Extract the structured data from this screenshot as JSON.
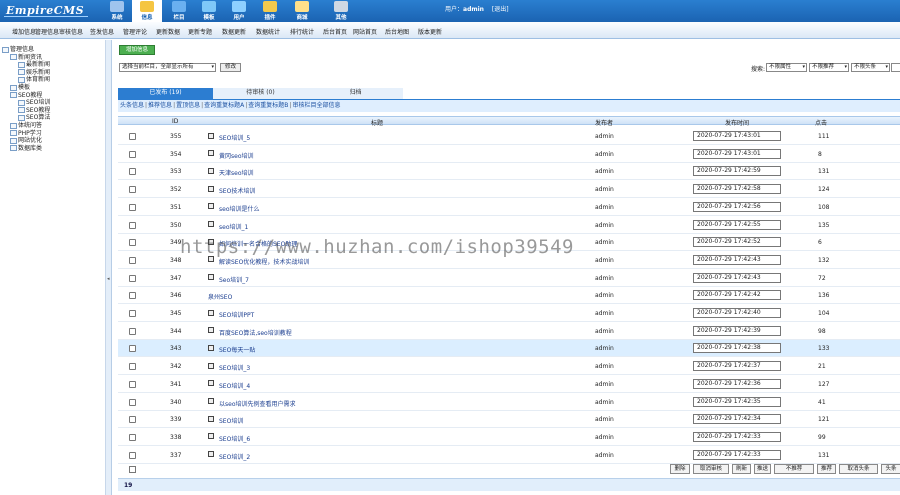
{
  "logo": "EmpireCMS",
  "topnav": [
    {
      "label": "系统",
      "icon": "system-icon",
      "color": "#9fc4ee"
    },
    {
      "label": "信息",
      "icon": "pencil-icon",
      "color": "#f5c542"
    },
    {
      "label": "栏目",
      "icon": "column-icon",
      "color": "#6ab0f0"
    },
    {
      "label": "模板",
      "icon": "template-icon",
      "color": "#7fc8f8"
    },
    {
      "label": "用户",
      "icon": "user-icon",
      "color": "#8ed0ff"
    },
    {
      "label": "插件",
      "icon": "plugin-icon",
      "color": "#f2c94c"
    },
    {
      "label": "商城",
      "icon": "shop-icon",
      "color": "#ffe08a"
    },
    {
      "label": "其他",
      "icon": "gear-icon",
      "color": "#cfd8e3"
    }
  ],
  "userinfo": {
    "prefix": "用户：",
    "user": "admin",
    "logout": "[退出]"
  },
  "menubar": [
    "增加信息",
    "管理信息",
    "审核信息",
    "签发信息",
    "管理评论",
    "更新数据",
    "更新专题",
    "数据更新",
    "数据统计",
    "排行统计",
    "后台首页",
    "网站首页",
    "后台地图",
    "版本更新"
  ],
  "sidebar": [
    {
      "label": "管理信息",
      "level": 0
    },
    {
      "label": "新闻资讯",
      "level": 1
    },
    {
      "label": "最新新闻",
      "level": 2
    },
    {
      "label": "娱乐新闻",
      "level": 2
    },
    {
      "label": "体育新闻",
      "level": 2
    },
    {
      "label": "模板",
      "level": 1
    },
    {
      "label": "SEO教程",
      "level": 1
    },
    {
      "label": "SEO培训",
      "level": 2
    },
    {
      "label": "SEO教程",
      "level": 2
    },
    {
      "label": "SEO算法",
      "level": 2
    },
    {
      "label": "体统问答",
      "level": 1
    },
    {
      "label": "PHP学习",
      "level": 1
    },
    {
      "label": "网站优化",
      "level": 1
    },
    {
      "label": "数据库类",
      "level": 1
    }
  ],
  "toolbar": {
    "add_button": "增加信息",
    "column_select": "选择当前栏目，全部显示所有",
    "set_button": "修改",
    "search_label": "搜索:",
    "filter1": "不限属性",
    "filter2": "不限推荐",
    "filter3": "不限头条"
  },
  "tabs": [
    {
      "label": "已发布 (19)"
    },
    {
      "label": "待审核 (0)"
    },
    {
      "label": "归档"
    }
  ],
  "actions": [
    "头条信息",
    "推荐信息",
    "置顶信息",
    "查询重复标题A",
    "查询重复标题B",
    "审核栏目全部信息"
  ],
  "headers": {
    "id": "ID",
    "title": "标题",
    "user": "发布者",
    "time": "发布时间",
    "hits": "点击"
  },
  "rows": [
    {
      "id": "355",
      "title": "SEO培训_5",
      "user": "admin",
      "time": "2020-07-29 17:43:01",
      "hits": "111",
      "icon": true,
      "hl": false
    },
    {
      "id": "354",
      "title": "黄冈seo培训",
      "user": "admin",
      "time": "2020-07-29 17:43:01",
      "hits": "8",
      "icon": true,
      "hl": false
    },
    {
      "id": "353",
      "title": "天津seo培训",
      "user": "admin",
      "time": "2020-07-29 17:42:59",
      "hits": "131",
      "icon": true,
      "hl": false
    },
    {
      "id": "352",
      "title": "SEO技术培训",
      "user": "admin",
      "time": "2020-07-29 17:42:58",
      "hits": "124",
      "icon": true,
      "hl": false
    },
    {
      "id": "351",
      "title": "seo培训是什么",
      "user": "admin",
      "time": "2020-07-29 17:42:56",
      "hits": "108",
      "icon": true,
      "hl": false
    },
    {
      "id": "350",
      "title": "seo培训_1",
      "user": "admin",
      "time": "2020-07-29 17:42:55",
      "hits": "135",
      "icon": true,
      "hl": false
    },
    {
      "id": "349",
      "title": "如何培训一名合格的SEO助理",
      "user": "admin",
      "time": "2020-07-29 17:42:52",
      "hits": "6",
      "icon": true,
      "hl": false
    },
    {
      "id": "348",
      "title": "解读SEO优化教程，技术实战培训",
      "user": "admin",
      "time": "2020-07-29 17:42:43",
      "hits": "132",
      "icon": true,
      "hl": false
    },
    {
      "id": "347",
      "title": "Seo培训_7",
      "user": "admin",
      "time": "2020-07-29 17:42:43",
      "hits": "72",
      "icon": true,
      "hl": false
    },
    {
      "id": "346",
      "title": "泉州SEO",
      "user": "admin",
      "time": "2020-07-29 17:42:42",
      "hits": "136",
      "icon": false,
      "hl": false
    },
    {
      "id": "345",
      "title": "SEO培训PPT",
      "user": "admin",
      "time": "2020-07-29 17:42:40",
      "hits": "104",
      "icon": true,
      "hl": false
    },
    {
      "id": "344",
      "title": "百度SEO算法,seo培训教程",
      "user": "admin",
      "time": "2020-07-29 17:42:39",
      "hits": "98",
      "icon": true,
      "hl": false
    },
    {
      "id": "343",
      "title": "SEO每天一贴",
      "user": "admin",
      "time": "2020-07-29 17:42:38",
      "hits": "133",
      "icon": true,
      "hl": true
    },
    {
      "id": "342",
      "title": "SEO培训_3",
      "user": "admin",
      "time": "2020-07-29 17:42:37",
      "hits": "21",
      "icon": true,
      "hl": false
    },
    {
      "id": "341",
      "title": "SEO培训_4",
      "user": "admin",
      "time": "2020-07-29 17:42:36",
      "hits": "127",
      "icon": true,
      "hl": false
    },
    {
      "id": "340",
      "title": "以seo培训先例查看用户需求",
      "user": "admin",
      "time": "2020-07-29 17:42:35",
      "hits": "41",
      "icon": true,
      "hl": false
    },
    {
      "id": "339",
      "title": "SEO培训",
      "user": "admin",
      "time": "2020-07-29 17:42:34",
      "hits": "121",
      "icon": true,
      "hl": false
    },
    {
      "id": "338",
      "title": "SEO培训_6",
      "user": "admin",
      "time": "2020-07-29 17:42:33",
      "hits": "99",
      "icon": true,
      "hl": false
    },
    {
      "id": "337",
      "title": "SEO培训_2",
      "user": "admin",
      "time": "2020-07-29 17:42:33",
      "hits": "131",
      "icon": true,
      "hl": false
    }
  ],
  "bottom_buttons": [
    "删除",
    "取消审核",
    "刷新",
    "推送",
    "不推荐",
    "推荐",
    "取消头条",
    "头条"
  ],
  "page_count": "19",
  "watermark": "https://www.huzhan.com/ishop39549"
}
